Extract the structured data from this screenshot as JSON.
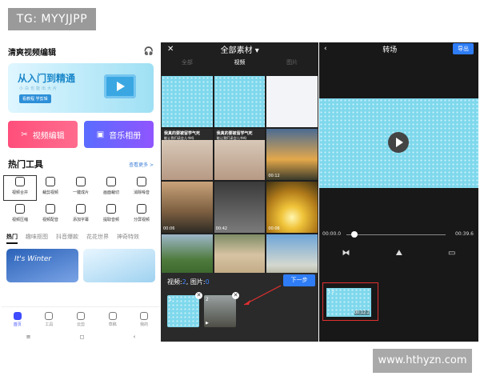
{
  "watermark_top": "TG: MYYJJPP",
  "watermark_bottom": "www.hthyzn.com",
  "panel1": {
    "title": "清爽视频编辑",
    "banner_title": "从入门到精通",
    "banner_sub": "小白也能出大片",
    "banner_tag": "看教程 学剪辑",
    "edit_btn": "视频编辑",
    "album_btn": "音乐相册",
    "hot_title": "热门工具",
    "more": "查看更多 >",
    "tools": [
      "视频合并",
      "裁剪视频",
      "一键成片",
      "画面裁切",
      "消除噪音",
      "视频压缩",
      "视频配音",
      "添加字幕",
      "提取音频",
      "分屏视频"
    ],
    "tabs": [
      "热门",
      "趣味抠图",
      "抖音爆款",
      "花花世界",
      "神奇特效"
    ],
    "card_text": "It's Winter",
    "nav": [
      "首页",
      "工具",
      "云剪",
      "草稿",
      "我的"
    ],
    "sys": [
      "≡",
      "◻",
      "‹"
    ]
  },
  "panel2": {
    "close": "✕",
    "title": "全部素材 ▾",
    "tabs": [
      "全部",
      "视频",
      "图片"
    ],
    "caption": "我真的要被留学气死",
    "caption_sub": "能让我们读会儿书吗",
    "durations": [
      "00:12",
      "00:06",
      "00:42",
      "00:06"
    ],
    "sel_prefix": "视频:",
    "sel_video_count": "2",
    "sel_mid": ", 图片:",
    "sel_image_count": "0",
    "next": "下一步",
    "pick_nums": [
      "1",
      "2"
    ]
  },
  "panel3": {
    "back": "‹",
    "title": "转场",
    "export": "导出",
    "time_start": "00:00.0",
    "time_end": "00:39.6",
    "tools": [
      "⧓",
      "⛰",
      "▭"
    ],
    "clip_nums": [
      "1",
      "2"
    ],
    "clip_duration": "00:12.2"
  },
  "colors": {
    "accent_blue": "#2f7df6",
    "highlight_red": "#e23030"
  }
}
